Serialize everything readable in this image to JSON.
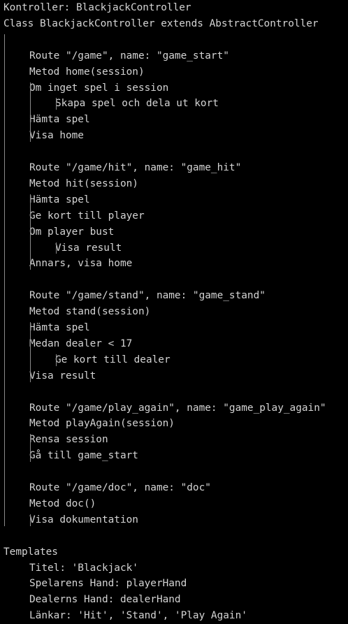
{
  "header": {
    "controller_line": "Kontroller: BlackjackController",
    "class_line": "Class BlackjackController extends AbstractController"
  },
  "routes": [
    {
      "route_line": "Route \"/game\", name: \"game_start\"",
      "method_line": "Metod home(session)",
      "body": [
        {
          "text": "Om inget spel i session",
          "depth": 2
        },
        {
          "text": "Skapa spel och dela ut kort",
          "depth": 3
        },
        {
          "text": "Hämta spel",
          "depth": 2
        },
        {
          "text": "Visa home",
          "depth": 2
        }
      ]
    },
    {
      "route_line": "Route \"/game/hit\", name: \"game_hit\"",
      "method_line": "Metod hit(session)",
      "body": [
        {
          "text": "Hämta spel",
          "depth": 2
        },
        {
          "text": "Ge kort till player",
          "depth": 2
        },
        {
          "text": "Om player bust",
          "depth": 2
        },
        {
          "text": "Visa result",
          "depth": 3
        },
        {
          "text": "Annars, visa home",
          "depth": 2
        }
      ]
    },
    {
      "route_line": "Route \"/game/stand\", name: \"game_stand\"",
      "method_line": "Metod stand(session)",
      "body": [
        {
          "text": "Hämta spel",
          "depth": 2
        },
        {
          "text": "Medan dealer < 17",
          "depth": 2
        },
        {
          "text": "Ge kort till dealer",
          "depth": 3
        },
        {
          "text": "Visa result",
          "depth": 2
        }
      ]
    },
    {
      "route_line": "Route \"/game/play_again\", name: \"game_play_again\"",
      "method_line": "Metod playAgain(session)",
      "body": [
        {
          "text": "Rensa session",
          "depth": 2
        },
        {
          "text": "Gå till game_start",
          "depth": 2
        }
      ]
    },
    {
      "route_line": "Route \"/game/doc\", name: \"doc\"",
      "method_line": "Metod doc()",
      "body": [
        {
          "text": "Visa dokumentation",
          "depth": 2
        }
      ]
    }
  ],
  "templates": {
    "heading": "Templates",
    "items": [
      "Titel: 'Blackjack'",
      "Spelarens Hand: playerHand",
      "Dealerns Hand: dealerHand",
      "Länkar: 'Hit', 'Stand', 'Play Again'"
    ]
  }
}
